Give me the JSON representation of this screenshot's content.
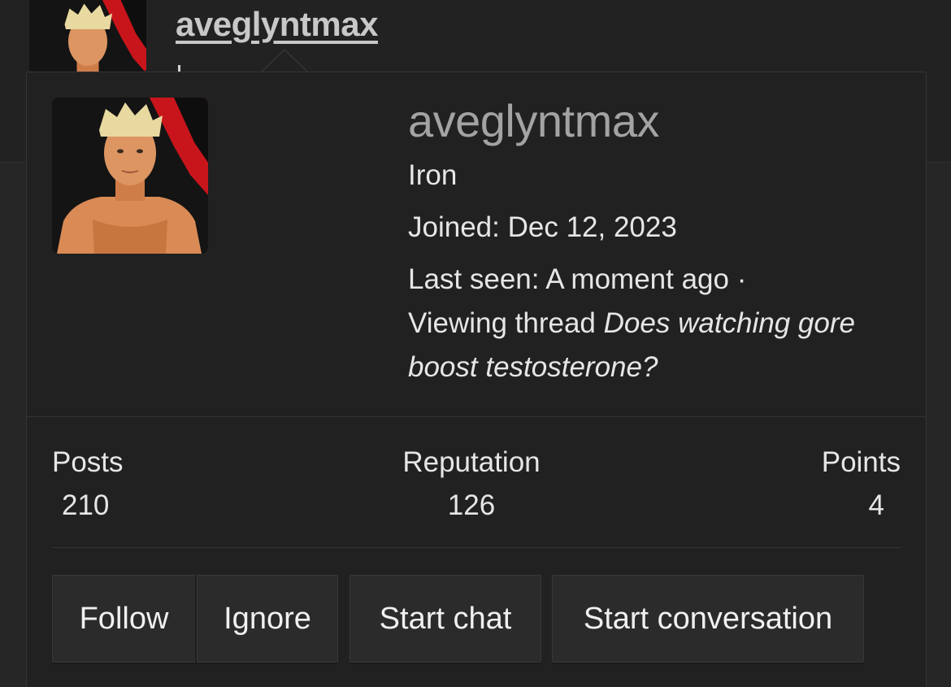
{
  "post": {
    "username": "aveglyntmax"
  },
  "tooltip": {
    "username": "aveglyntmax",
    "user_title": "Iron",
    "joined_label": "Joined:",
    "joined_date": "Dec 12, 2023",
    "last_seen_label": "Last seen:",
    "last_seen_value": "A moment ago ·",
    "activity_prefix": "Viewing thread",
    "activity_thread": "Does watching gore boost testosterone?"
  },
  "stats": {
    "posts_label": "Posts",
    "posts_value": "210",
    "reputation_label": "Reputation",
    "reputation_value": "126",
    "points_label": "Points",
    "points_value": "4"
  },
  "actions": {
    "follow": "Follow",
    "ignore": "Ignore",
    "start_chat": "Start chat",
    "start_conversation": "Start conversation"
  },
  "colors": {
    "background": "#262626",
    "card": "#212121",
    "username_muted": "#a3a3a3",
    "avatar_red": "#c8151b"
  }
}
